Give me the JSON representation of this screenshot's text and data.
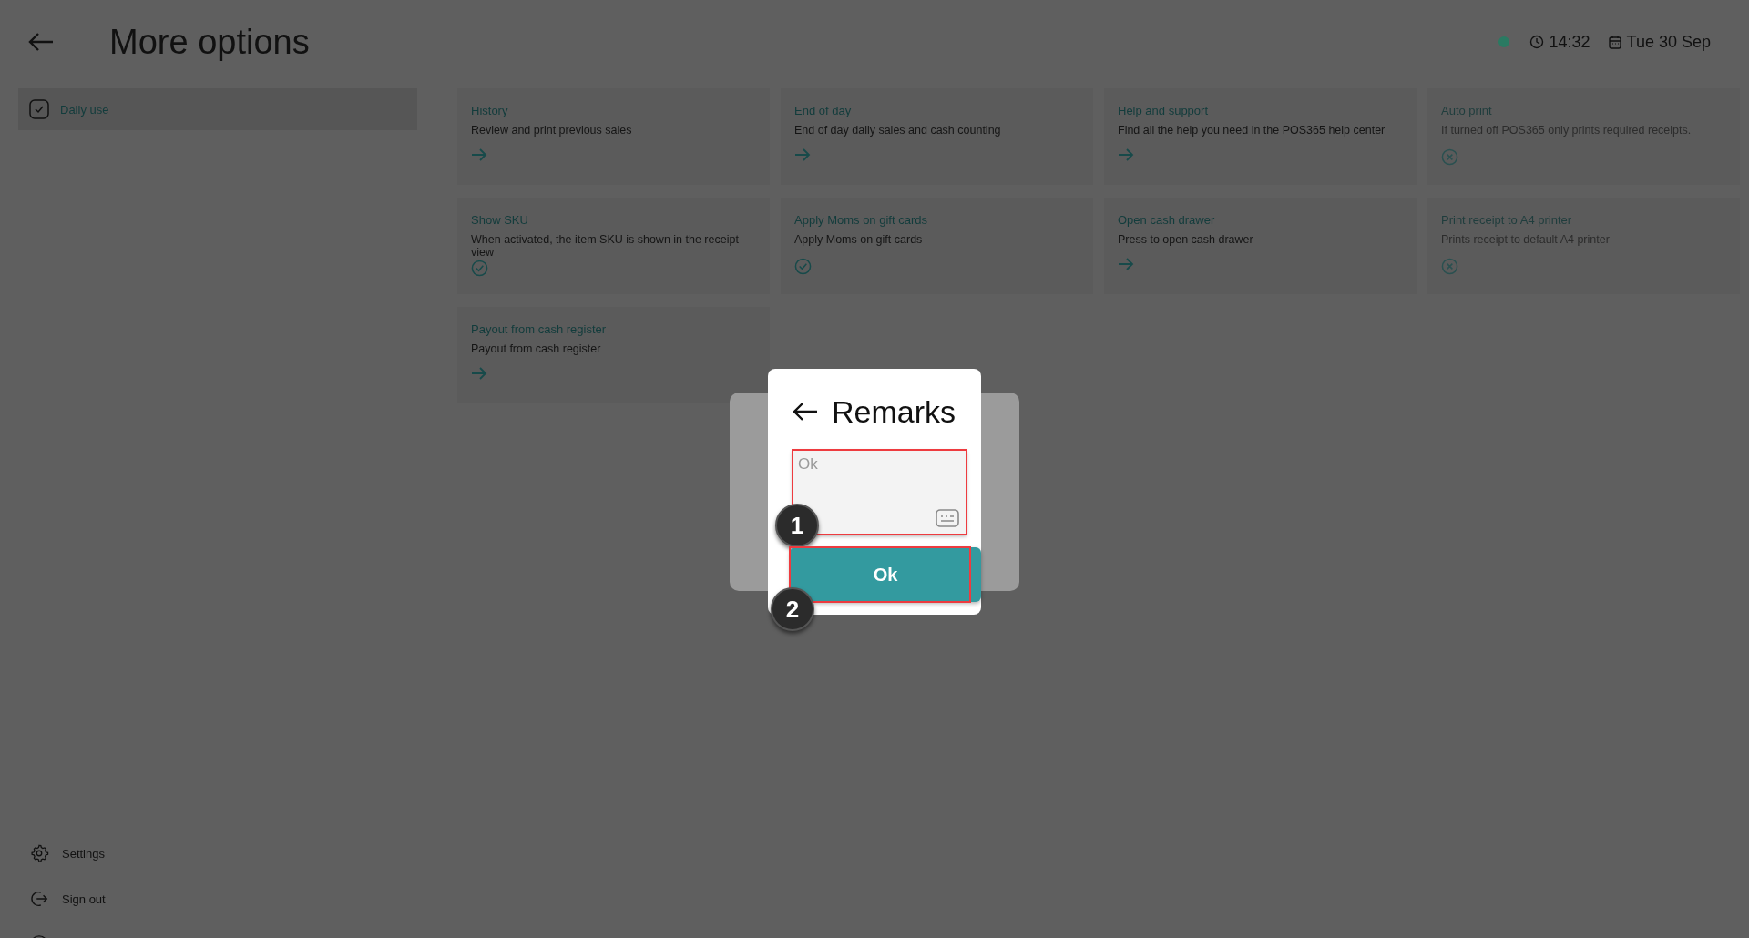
{
  "header": {
    "title": "More options",
    "time": "14:32",
    "date": "Tue 30 Sep",
    "online": true
  },
  "sidebar": {
    "items": [
      {
        "label": "Daily use",
        "selected": true
      }
    ],
    "footer_items": [
      {
        "label": "Settings",
        "kind": "settings"
      },
      {
        "label": "Sign out",
        "kind": "signout"
      },
      {
        "kind": "more"
      }
    ]
  },
  "cards": [
    {
      "title": "History",
      "description": "Review and print previous sales",
      "kind": "link",
      "disabled": false
    },
    {
      "title": "End of day",
      "description": "End of day daily sales and cash counting",
      "kind": "link",
      "disabled": false
    },
    {
      "title": "Help and support",
      "description": "Find all the help you need in the POS365 help center",
      "kind": "link",
      "disabled": false
    },
    {
      "title": "Auto print",
      "description": "If turned off POS365 only prints required receipts.",
      "kind": "toggle",
      "on": false,
      "disabled": true
    },
    {
      "title": "Show SKU",
      "description": "When activated, the item SKU is shown in the receipt view",
      "kind": "toggle",
      "on": true,
      "disabled": false
    },
    {
      "title": "Apply Moms on gift cards",
      "description": "Apply Moms on gift cards",
      "kind": "toggle",
      "on": true,
      "disabled": false
    },
    {
      "title": "Open cash drawer",
      "description": "Press to open cash drawer",
      "kind": "link",
      "disabled": false
    },
    {
      "title": "Print receipt to A4 printer",
      "description": "Prints receipt to default A4 printer",
      "kind": "toggle",
      "on": false,
      "disabled": true
    },
    {
      "title": "Payout from cash register",
      "description": "Payout from cash register",
      "kind": "link",
      "disabled": false
    }
  ],
  "dialog": {
    "title": "Remarks",
    "field": {
      "placeholder": "Ok"
    },
    "button": "Ok"
  },
  "annotations": [
    {
      "label": "1"
    },
    {
      "label": "2"
    }
  ]
}
